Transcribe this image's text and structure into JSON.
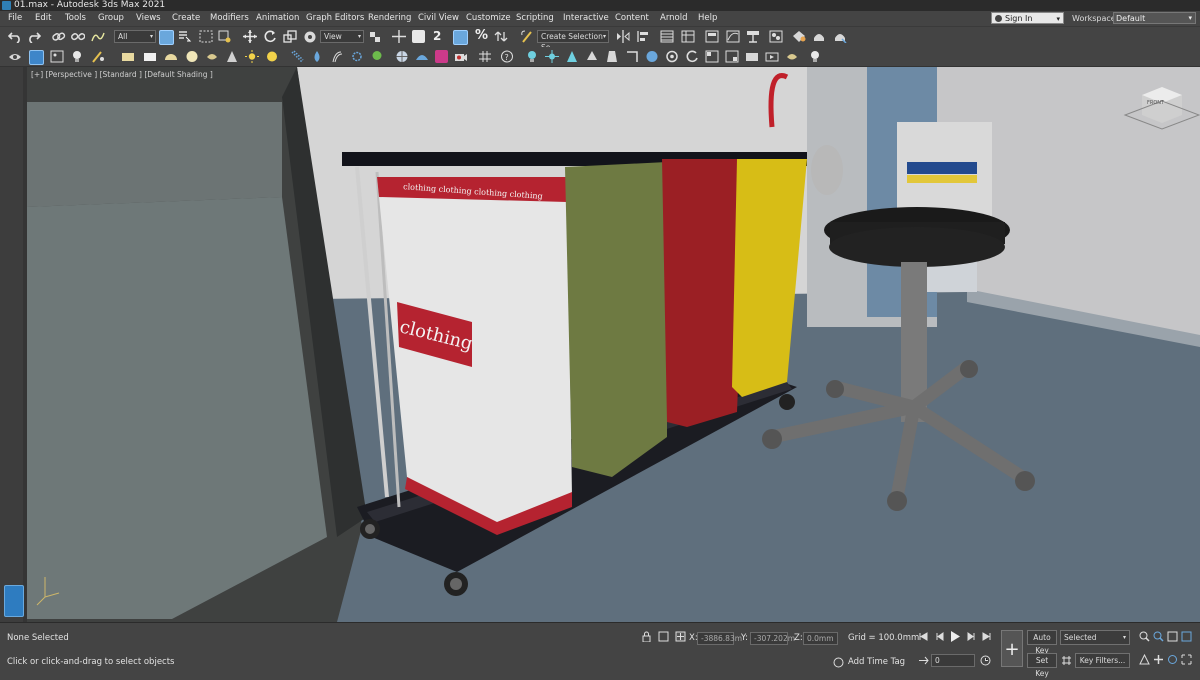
{
  "window": {
    "title": "01.max - Autodesk 3ds Max 2021"
  },
  "menu": [
    "File",
    "Edit",
    "Tools",
    "Group",
    "Views",
    "Create",
    "Modifiers",
    "Animation",
    "Graph Editors",
    "Rendering",
    "Civil View",
    "Customize",
    "Scripting",
    "Interactive",
    "Content",
    "Arnold",
    "Help"
  ],
  "account": {
    "sign_in": "Sign In",
    "workspaces_label": "Workspaces:",
    "workspace_value": "Default"
  },
  "toolbar": {
    "selection_filter": "All",
    "ref_coord": "View",
    "named_selection": "Create Selection Se"
  },
  "snap": {
    "angle_label": "2",
    "scale_label": "%"
  },
  "viewport": {
    "label": "[+] [Perspective ] [Standard ] [Default Shading ]",
    "viewcube_label": "FRONT"
  },
  "scene": {
    "bag_white_text": "clothing",
    "bag_white_band": "clothing  clothing  clothing  clothing"
  },
  "status": {
    "selection": "None Selected",
    "prompt": "Click or click-and-drag to select objects",
    "x_label": "X:",
    "x_value": "-3886.83m",
    "y_label": "Y:",
    "y_value": "-307.202m",
    "z_label": "Z:",
    "z_value": "0.0mm",
    "grid": "Grid = 100.0mm",
    "add_time_tag": "Add Time Tag",
    "auto_key": "Auto Key",
    "set_key": "Set Key",
    "selected_dd": "Selected",
    "key_filters": "Key Filters...",
    "frame": "0"
  }
}
